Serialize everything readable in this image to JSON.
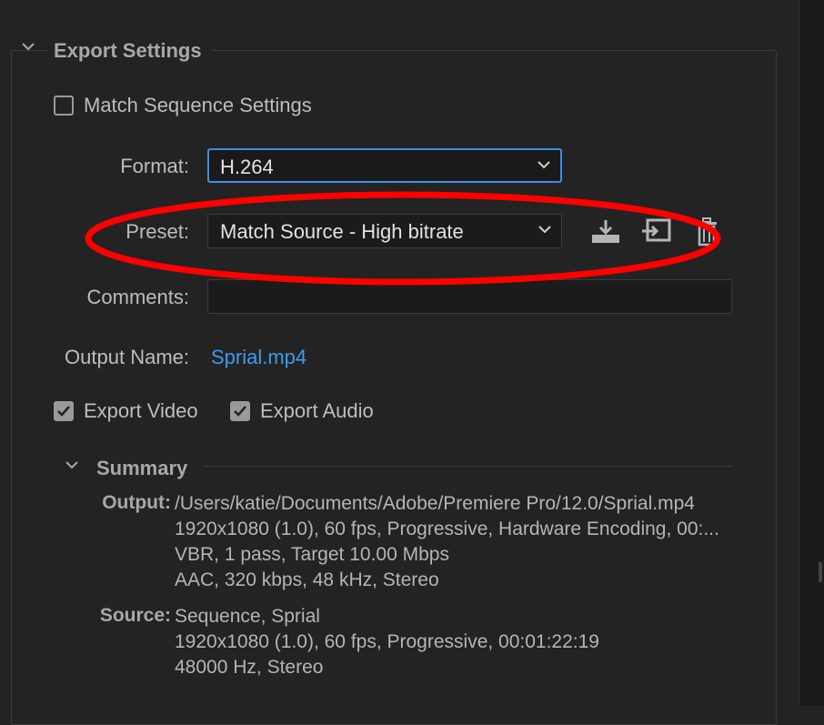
{
  "section": {
    "title": "Export Settings"
  },
  "match_sequence": {
    "label": "Match Sequence Settings",
    "checked": false
  },
  "format": {
    "label": "Format:",
    "value": "H.264"
  },
  "preset": {
    "label": "Preset:",
    "value": "Match Source - High bitrate"
  },
  "comments": {
    "label": "Comments:",
    "value": ""
  },
  "output_name": {
    "label": "Output Name:",
    "value": "Sprial.mp4"
  },
  "export_video": {
    "label": "Export Video",
    "checked": true
  },
  "export_audio": {
    "label": "Export Audio",
    "checked": true
  },
  "summary": {
    "title": "Summary",
    "output": {
      "label": "Output:",
      "lines": [
        "/Users/katie/Documents/Adobe/Premiere Pro/12.0/Sprial.mp4",
        "1920x1080 (1.0), 60 fps, Progressive, Hardware Encoding, 00:...",
        "VBR, 1 pass, Target 10.00 Mbps",
        "AAC, 320 kbps, 48 kHz, Stereo"
      ]
    },
    "source": {
      "label": "Source:",
      "lines": [
        "Sequence, Sprial",
        "1920x1080 (1.0), 60 fps, Progressive, 00:01:22:19",
        "48000 Hz, Stereo"
      ]
    }
  },
  "icons": {
    "save_preset": "download-icon",
    "import_preset": "import-icon",
    "delete_preset": "trash-icon"
  },
  "colors": {
    "focus_border": "#3d8ee8",
    "link": "#3d9bf0",
    "annotation": "#ff0000"
  }
}
